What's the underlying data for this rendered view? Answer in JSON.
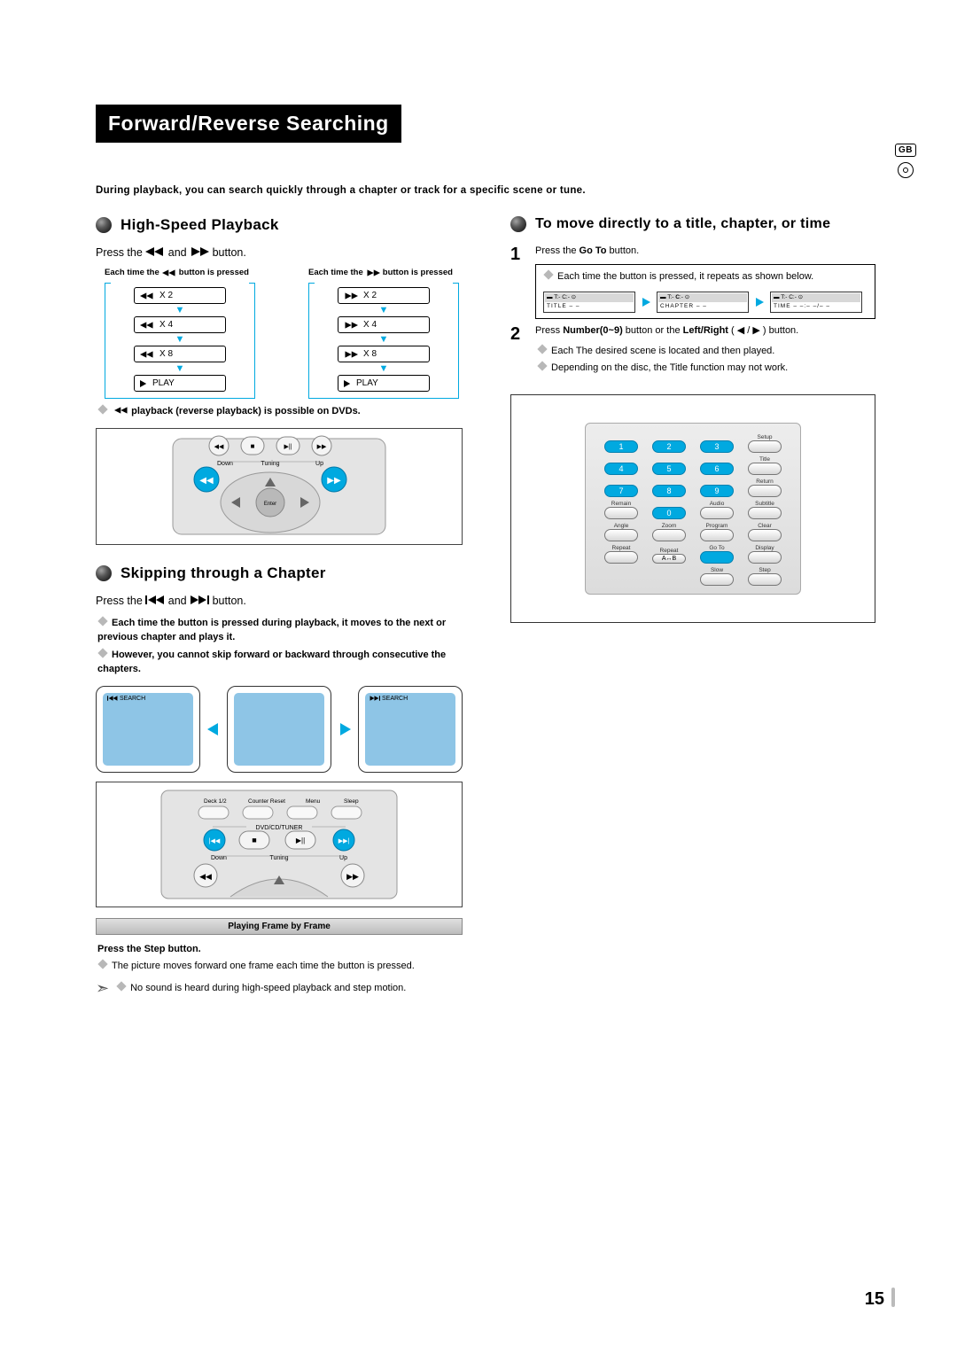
{
  "title": "Forward/Reverse Searching",
  "intro": "During playback, you can search quickly through a chapter or track for a specific scene or tune.",
  "side": {
    "lang": "GB"
  },
  "left": {
    "h1": "High-Speed Playback",
    "press_prefix": "Press the",
    "press_mid": "and",
    "press_suffix": "button.",
    "head_left": "Each time the",
    "head_left2": "button is pressed",
    "head_right": "Each time the",
    "head_right2": "button is pressed",
    "speeds_left": [
      "X 2",
      "X 4",
      "X 8"
    ],
    "speeds_right": [
      "X 2",
      "X 4",
      "X 8"
    ],
    "play": "PLAY",
    "reverse_note": "playback (reverse playback) is possible on DVDs.",
    "skip_title": "Skipping through a Chapter",
    "skip_press_prefix": "Press the",
    "skip_press_mid": "and",
    "skip_press_suffix": "button.",
    "skip_note1": "Each time the button is pressed during playback, it moves to the next or previous chapter and plays it.",
    "skip_note2": "However, you cannot skip forward or backward through consecutive the chapters.",
    "search_label": "SEARCH",
    "frame_bar": "Playing Frame by Frame",
    "step_instr": "Press the Step button.",
    "step_note": "The picture moves forward one frame each time the button is pressed.",
    "sound_note": "No sound is heard during high-speed playback and step motion.",
    "remote_labels": {
      "down": "Down",
      "tuning": "Tuning",
      "up": "Up",
      "enter": "Enter",
      "deck": "Deck 1/2",
      "counter": "Counter Reset",
      "menu": "Menu",
      "sleep": "Sleep",
      "mode": "DVD/CD/TUNER"
    }
  },
  "right": {
    "h1": "To move directly to a title, chapter, or time",
    "step1_prefix": "Press the ",
    "step1_btn": "Go To",
    "step1_suffix": " button.",
    "step1_note": "Each time the button is pressed, it repeats as shown below.",
    "goto": {
      "title_hdr": "T:- C:- ",
      "title": "TITLE – –",
      "chapter": "CHAPTER – –",
      "time": "TIME – –:– –/– –"
    },
    "step2_prefix": "Press ",
    "step2_num": "Number(0~9)",
    "step2_mid": " button or the ",
    "step2_lr": "Left/Right",
    "step2_paren": " ( ◀ / ▶ ) button.",
    "step2_note1": "Each The desired scene is located and then played.",
    "step2_note2": "Depending on the disc, the Title function may not work.",
    "keypad": {
      "row1": [
        "1",
        "2",
        "3"
      ],
      "row2": [
        "4",
        "5",
        "6"
      ],
      "row3": [
        "7",
        "8",
        "9"
      ],
      "zero": "0",
      "labels": {
        "setup": "Setup",
        "title": "Title",
        "return": "Return",
        "remain": "Remain",
        "audio": "Audio",
        "subtitle": "Subtitle",
        "angle": "Angle",
        "zoom": "Zoom",
        "program": "Program",
        "clear": "Clear",
        "repeat": "Repeat",
        "repeat_ab": "Repeat",
        "ab": "A↔B",
        "goto": "Go To",
        "display": "Display",
        "slow": "Slow",
        "step": "Step"
      }
    }
  },
  "page_number": "15"
}
